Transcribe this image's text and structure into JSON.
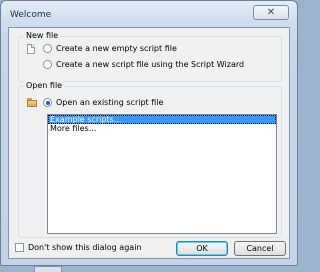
{
  "window": {
    "title": "Welcome",
    "close_glyph": "✕"
  },
  "new_file": {
    "legend": "New file",
    "icon": "document-icon",
    "options": [
      {
        "label": "Create a new empty script file",
        "checked": false
      },
      {
        "label": "Create a new script file using the Script Wizard",
        "checked": false
      }
    ]
  },
  "open_file": {
    "legend": "Open file",
    "icon": "folder-icon",
    "option": {
      "label": "Open an existing script file",
      "checked": true
    },
    "list": {
      "items": [
        {
          "label": "Example scripts...",
          "selected": true
        },
        {
          "label": "More files...",
          "selected": false
        }
      ]
    }
  },
  "footer": {
    "dont_show_label": "Don't show this dialog again",
    "dont_show_checked": false,
    "ok_label": "OK",
    "cancel_label": "Cancel"
  },
  "colors": {
    "selection": "#3399ff",
    "chrome": "#c6d7ea"
  }
}
